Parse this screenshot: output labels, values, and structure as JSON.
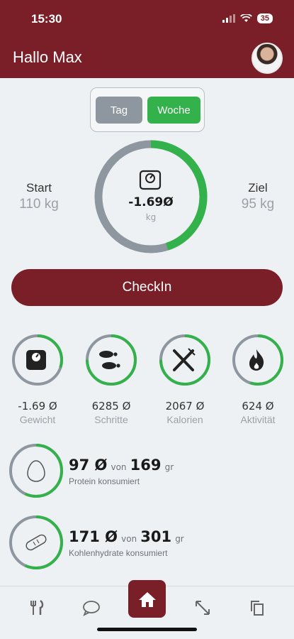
{
  "status_bar": {
    "time": "15:30",
    "battery": "35"
  },
  "header": {
    "greeting": "Hallo Max"
  },
  "period_toggle": {
    "options": [
      "Tag",
      "Woche"
    ],
    "selected": "Woche"
  },
  "weight_overview": {
    "start_label": "Start",
    "start_value": "110 kg",
    "goal_label": "Ziel",
    "goal_value": "95 kg",
    "center_value": "-1.69Ø",
    "center_unit": "kg",
    "progress_fraction": 0.45
  },
  "checkin_label": "CheckIn",
  "stats": [
    {
      "value": "-1.69 Ø",
      "label": "Gewicht",
      "icon": "scale-icon",
      "progress_fraction": 0.3
    },
    {
      "value": "6285 Ø",
      "label": "Schritte",
      "icon": "footsteps-icon",
      "progress_fraction": 0.75
    },
    {
      "value": "2067 Ø",
      "label": "Kalorien",
      "icon": "cutlery-icon",
      "progress_fraction": 0.75
    },
    {
      "value": "624 Ø",
      "label": "Aktivität",
      "icon": "flame-icon",
      "progress_fraction": 0.55
    }
  ],
  "macros": [
    {
      "value": "97 Ø",
      "of_label": "von",
      "target": "169",
      "unit": "gr",
      "label": "Protein konsumiert",
      "icon": "egg-icon",
      "progress_fraction": 0.57
    },
    {
      "value": "171 Ø",
      "of_label": "von",
      "target": "301",
      "unit": "gr",
      "label": "Kohlenhydrate konsumiert",
      "icon": "bread-icon",
      "progress_fraction": 0.57
    }
  ],
  "tabbar": {
    "items": [
      "cutlery-tab-icon",
      "chat-tab-icon",
      "home-tab-icon",
      "arrows-tab-icon",
      "copy-tab-icon"
    ],
    "active": "home-tab-icon"
  },
  "colors": {
    "primary": "#7a1f27",
    "accent_green": "#33b14a",
    "ring_grey": "#8e979f",
    "background": "#eef1f3"
  }
}
